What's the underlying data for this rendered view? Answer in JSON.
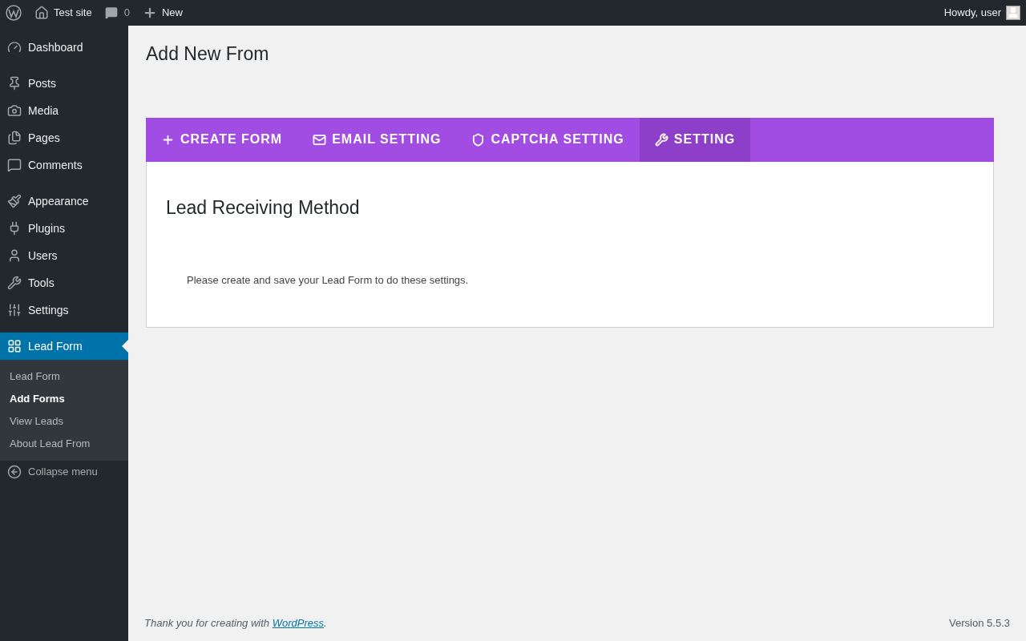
{
  "admin_bar": {
    "site": "Test site",
    "comments": "0",
    "new": "New",
    "greeting": "Howdy, user"
  },
  "sidebar": {
    "groups": [
      [
        {
          "label": "Dashboard",
          "selected": false
        }
      ],
      [
        {
          "label": "Posts",
          "selected": false
        },
        {
          "label": "Media",
          "selected": false
        },
        {
          "label": "Pages",
          "selected": false
        },
        {
          "label": "Comments",
          "selected": false
        }
      ],
      [
        {
          "label": "Appearance",
          "selected": false
        },
        {
          "label": "Plugins",
          "selected": false
        },
        {
          "label": "Users",
          "selected": false
        },
        {
          "label": "Tools",
          "selected": false
        },
        {
          "label": "Settings",
          "selected": false
        }
      ],
      [
        {
          "label": "Lead Form",
          "selected": true
        }
      ]
    ],
    "submenu": [
      {
        "label": "Lead Form",
        "selected": false
      },
      {
        "label": "Add Forms",
        "selected": true
      },
      {
        "label": "View Leads",
        "selected": false
      },
      {
        "label": "About Lead From",
        "selected": false
      }
    ],
    "collapse": "Collapse menu"
  },
  "page_title": "Add New From",
  "tabs": [
    {
      "label": "CREATE FORM",
      "selected": false
    },
    {
      "label": "EMAIL SETTING",
      "selected": false
    },
    {
      "label": "CAPTCHA SETTING",
      "selected": false
    },
    {
      "label": "SETTING",
      "selected": true
    }
  ],
  "panel": {
    "heading": "Lead Receiving Method",
    "message": "Please create and save your Lead Form to do these settings."
  },
  "footer": {
    "text": "Thank you for creating with ",
    "link": "WordPress",
    "end": ".",
    "version": "Version 5.5.3"
  }
}
